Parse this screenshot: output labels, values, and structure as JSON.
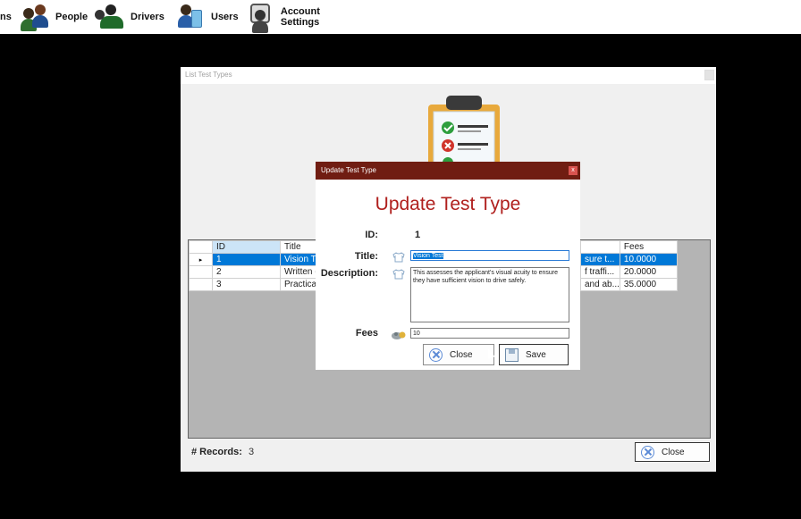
{
  "menubar": {
    "items": [
      {
        "label": "ns"
      },
      {
        "label": "People"
      },
      {
        "label": "Drivers"
      },
      {
        "label": "Users"
      },
      {
        "label": "Account Settings"
      }
    ]
  },
  "list_window": {
    "title": "List Test Types",
    "columns": [
      "ID",
      "Title",
      "Fees"
    ],
    "rows": [
      {
        "id": "1",
        "title": "Vision Te",
        "desc_tail": "sure t...",
        "fees": "10.0000",
        "selected": true
      },
      {
        "id": "2",
        "title": "Written (",
        "desc_tail": "f traffi...",
        "fees": "20.0000",
        "selected": false
      },
      {
        "id": "3",
        "title": "Practical",
        "desc_tail": "and ab...",
        "fees": "35.0000",
        "selected": false
      }
    ],
    "row_marker": "▸",
    "records_label": "# Records:",
    "records_value": "3",
    "close_label": "Close"
  },
  "dialog": {
    "window_title": "Update Test Type",
    "close_glyph": "x",
    "heading": "Update Test Type",
    "id_label": "ID:",
    "id_value": "1",
    "title_label": "Title:",
    "title_value": "Vision Test",
    "description_label": "Description:",
    "description_value": "This assesses the applicant's visual acuity to ensure they have sufficient vision to drive safely.",
    "fees_label": "Fees",
    "fees_value": "10",
    "close_button": "Close",
    "save_button": "Save"
  },
  "colors": {
    "dialog_titlebar": "#701d12",
    "heading": "#b0201e",
    "selection": "#0078d7",
    "accent_icon": "#5b8ad6"
  }
}
